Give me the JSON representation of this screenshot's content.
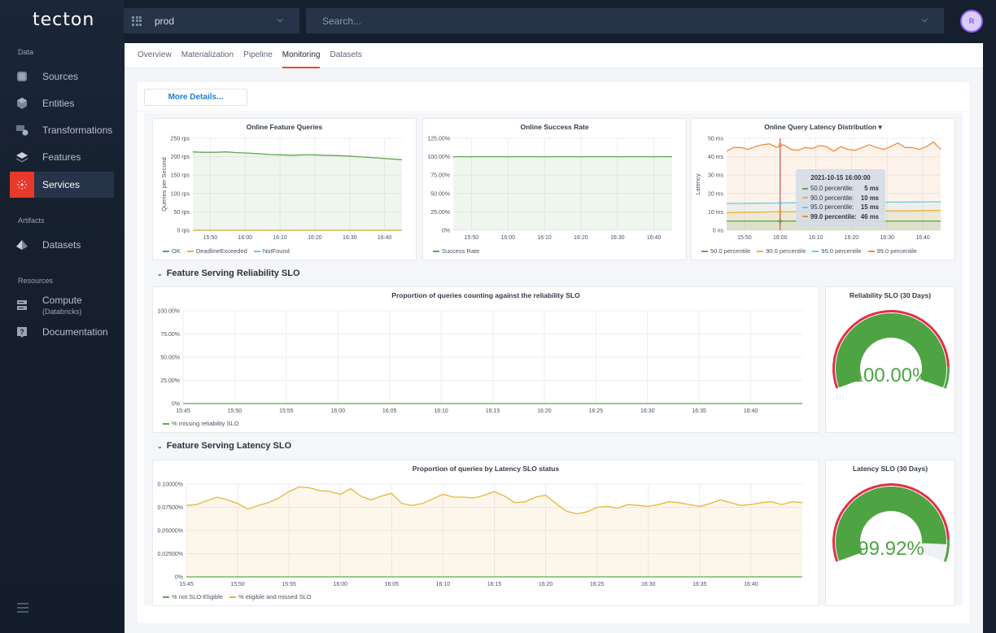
{
  "app": {
    "logo": "tecton"
  },
  "topbar": {
    "environment": "prod",
    "search_placeholder": "Search...",
    "avatar_initial": "R"
  },
  "sidebar": {
    "sections": [
      {
        "label": "Data",
        "items": [
          {
            "label": "Sources",
            "icon": "database-icon"
          },
          {
            "label": "Entities",
            "icon": "cube-icon"
          },
          {
            "label": "Transformations",
            "icon": "transform-icon"
          },
          {
            "label": "Features",
            "icon": "layers-icon"
          },
          {
            "label": "Services",
            "icon": "services-icon",
            "active": true
          }
        ]
      },
      {
        "label": "Artifacts",
        "items": [
          {
            "label": "Datasets",
            "icon": "pyramid-icon"
          }
        ]
      },
      {
        "label": "Resources",
        "items": [
          {
            "label": "Compute",
            "sublabel": "(Databricks)",
            "icon": "server-icon"
          },
          {
            "label": "Documentation",
            "icon": "help-icon"
          }
        ]
      }
    ]
  },
  "tabs": [
    {
      "label": "Overview"
    },
    {
      "label": "Materialization"
    },
    {
      "label": "Pipeline"
    },
    {
      "label": "Monitoring",
      "active": true
    },
    {
      "label": "Datasets"
    }
  ],
  "dashboard": {
    "more_details_label": "More Details...",
    "rows": [
      {
        "title": "Feature Serving Reliability SLO"
      },
      {
        "title": "Feature Serving Latency SLO"
      }
    ],
    "tooltip": {
      "title": "2021-10-15 16:00:00",
      "rows": [
        {
          "label": "50.0 percentile:",
          "value": "5 ms",
          "color": "#5fa84e"
        },
        {
          "label": "90.0 percentile:",
          "value": "10 ms",
          "color": "#e9b43a"
        },
        {
          "label": "95.0 percentile:",
          "value": "15 ms",
          "color": "#67cde0"
        },
        {
          "label": "99.0 percentile:",
          "value": "46 ms",
          "color": "#f08a3c",
          "bold": true
        }
      ]
    }
  },
  "chart_data": [
    {
      "id": "online-feature-queries",
      "type": "line",
      "title": "Online Feature Queries",
      "ylabel": "Queries per Second",
      "xlabel": "",
      "ylim": [
        0,
        250
      ],
      "yticks": [
        "0 rps",
        "50 rps",
        "100 rps",
        "150 rps",
        "200 rps",
        "250 rps"
      ],
      "xticks": [
        "15:50",
        "16:00",
        "16:10",
        "16:20",
        "16:30",
        "16:40"
      ],
      "x_range_min": [
        0,
        60
      ],
      "xtick_min": [
        5,
        15,
        25,
        35,
        45,
        55
      ],
      "legend": "bottom-left",
      "series": [
        {
          "name": "OK",
          "color": "#5fa84e",
          "fill": true,
          "values": [
            213,
            212,
            212,
            213,
            211,
            210,
            208,
            206,
            205,
            204,
            205,
            205,
            204,
            203,
            202,
            200,
            198,
            196,
            194,
            192
          ]
        },
        {
          "name": "DeadlineExceeded",
          "color": "#e9b43a",
          "values": [
            0,
            0,
            0,
            0,
            0,
            0,
            0,
            0,
            0,
            0,
            0,
            0,
            0,
            0,
            0,
            0,
            0,
            0,
            0,
            0
          ]
        },
        {
          "name": "NotFound",
          "color": "#67cde0",
          "values": [
            0,
            0,
            0,
            0,
            0,
            0,
            0,
            0,
            0,
            0,
            0,
            0,
            0,
            0,
            0,
            0,
            0,
            0,
            0,
            0
          ]
        }
      ]
    },
    {
      "id": "online-success-rate",
      "type": "line",
      "title": "Online Success Rate",
      "ylim": [
        0,
        125
      ],
      "yticks": [
        "0%",
        "25.00%",
        "50.00%",
        "75.00%",
        "100.00%",
        "125.00%"
      ],
      "xticks": [
        "15:50",
        "16:00",
        "16:10",
        "16:20",
        "16:30",
        "16:40"
      ],
      "x_range_min": [
        0,
        60
      ],
      "xtick_min": [
        5,
        15,
        25,
        35,
        45,
        55
      ],
      "legend": "bottom-left",
      "series": [
        {
          "name": "Success Rate",
          "color": "#5fa84e",
          "fill": true,
          "values": [
            100,
            100,
            100,
            100,
            100,
            100,
            100,
            100,
            100,
            100,
            100,
            100,
            100,
            100,
            100,
            100,
            100,
            100,
            100,
            100
          ]
        }
      ]
    },
    {
      "id": "online-query-latency-distribution",
      "type": "line",
      "title": "Online Query Latency Distribution",
      "ylabel": "Latency",
      "ylim": [
        0,
        50
      ],
      "yticks": [
        "0 ns",
        "10 ms",
        "20 ms",
        "30 ms",
        "40 ms",
        "50 ms"
      ],
      "xticks": [
        "15:50",
        "16:00",
        "16:10",
        "16:20",
        "16:30",
        "16:40"
      ],
      "x_range_min": [
        0,
        60
      ],
      "xtick_min": [
        5,
        15,
        25,
        35,
        45,
        55
      ],
      "crosshair_min": 15,
      "legend": "bottom-left",
      "series": [
        {
          "name": "50.0 percentile",
          "color": "#5fa84e",
          "fill": true,
          "values": [
            5,
            5,
            5,
            5,
            5,
            5,
            5,
            5,
            5,
            5,
            5,
            5,
            5,
            5,
            5,
            5,
            5,
            5,
            5,
            5,
            5,
            5,
            5,
            5,
            5,
            5,
            5,
            5,
            5,
            5
          ]
        },
        {
          "name": "90.0 percentile",
          "color": "#e9b43a",
          "fill": true,
          "values": [
            9.5,
            9.6,
            9.7,
            9.8,
            9.8,
            9.9,
            10,
            10,
            10,
            10.1,
            10.1,
            10.1,
            10.2,
            10.2,
            10.3,
            10.3,
            10.3,
            10.4,
            10.4,
            10.4,
            10.5,
            10.5,
            10.5,
            10.6,
            10.6,
            10.6,
            10.7,
            10.7,
            10.8,
            10.8
          ]
        },
        {
          "name": "95.0 percentile",
          "color": "#67cde0",
          "fill": true,
          "values": [
            14.5,
            14.6,
            14.6,
            14.7,
            14.7,
            14.8,
            14.8,
            14.8,
            14.9,
            14.9,
            15,
            15,
            15,
            15,
            15,
            15.1,
            15.1,
            15.1,
            15.2,
            15.2,
            15.2,
            15.2,
            15.3,
            15.3,
            15.3,
            15.4,
            15.4,
            15.5,
            15.5,
            15.4
          ]
        },
        {
          "name": "99.0 percentile",
          "color": "#f08a3c",
          "fill": true,
          "values": [
            43,
            45,
            45,
            44,
            45.5,
            46.5,
            47,
            45,
            46.5,
            44,
            43.5,
            45,
            44.5,
            46,
            45.5,
            43,
            45.5,
            44,
            43.5,
            45,
            46.5,
            45,
            44,
            45.5,
            47.5,
            45,
            45,
            44,
            45.5,
            48,
            44
          ]
        }
      ]
    },
    {
      "id": "reliability-slo-proportion",
      "type": "line",
      "title": "Proportion of queries counting against the reliability SLO",
      "ylim": [
        0,
        100
      ],
      "yticks": [
        "0%",
        "25.00%",
        "50.00%",
        "75.00%",
        "100.00%"
      ],
      "xticks": [
        "15:45",
        "15:50",
        "15:55",
        "16:00",
        "16:05",
        "16:10",
        "16:15",
        "16:20",
        "16:25",
        "16:30",
        "16:35",
        "16:40"
      ],
      "x_range_min": [
        0,
        60
      ],
      "xtick_min": [
        0,
        5,
        10,
        15,
        20,
        25,
        30,
        35,
        40,
        45,
        50,
        55
      ],
      "legend": "bottom-left",
      "series": [
        {
          "name": "% missing reliability SLO",
          "color": "#5fa84e",
          "values": [
            0,
            0,
            0,
            0,
            0,
            0,
            0,
            0,
            0,
            0,
            0,
            0,
            0
          ]
        }
      ]
    },
    {
      "id": "reliability-slo-30d",
      "type": "gauge",
      "title": "Reliability SLO (30 Days)",
      "value": 100.0,
      "display": "100.00%",
      "threshold": 99.9
    },
    {
      "id": "latency-slo-proportion",
      "type": "area",
      "title": "Proportion of queries by Latency SLO status",
      "ylim": [
        0,
        0.1
      ],
      "yticks": [
        "0%",
        "0.02500%",
        "0.05000%",
        "0.07500%",
        "0.10000%"
      ],
      "xticks": [
        "15:45",
        "15:50",
        "15:55",
        "16:00",
        "16:05",
        "16:10",
        "16:15",
        "16:20",
        "16:25",
        "16:30",
        "16:35",
        "16:40"
      ],
      "x_range_min": [
        0,
        60
      ],
      "xtick_min": [
        0,
        5,
        10,
        15,
        20,
        25,
        30,
        35,
        40,
        45,
        50,
        55
      ],
      "legend": "bottom-left",
      "series": [
        {
          "name": "% not SLO-Eligible",
          "color": "#5fa84e",
          "values": [
            0,
            0,
            0,
            0,
            0,
            0,
            0,
            0,
            0,
            0,
            0,
            0,
            0
          ]
        },
        {
          "name": "% eligible and missed SLO",
          "color": "#e9b43a",
          "fill": true,
          "values": [
            0.077,
            0.078,
            0.082,
            0.086,
            0.083,
            0.079,
            0.073,
            0.077,
            0.08,
            0.085,
            0.092,
            0.097,
            0.096,
            0.093,
            0.092,
            0.089,
            0.095,
            0.087,
            0.083,
            0.087,
            0.09,
            0.079,
            0.077,
            0.079,
            0.084,
            0.089,
            0.086,
            0.086,
            0.085,
            0.088,
            0.092,
            0.087,
            0.08,
            0.081,
            0.086,
            0.088,
            0.079,
            0.071,
            0.068,
            0.07,
            0.075,
            0.076,
            0.074,
            0.078,
            0.077,
            0.076,
            0.078,
            0.081,
            0.08,
            0.078,
            0.076,
            0.079,
            0.083,
            0.08,
            0.077,
            0.078,
            0.08,
            0.081,
            0.078,
            0.081,
            0.08
          ]
        }
      ]
    },
    {
      "id": "latency-slo-30d",
      "type": "gauge",
      "title": "Latency SLO (30 Days)",
      "value": 99.92,
      "display": "99.92%",
      "threshold": 99.9
    }
  ]
}
